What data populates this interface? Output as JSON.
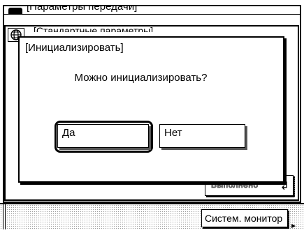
{
  "window": {
    "title": "[Параметры передачи]",
    "panel_title": "[Стандартные параметры]"
  },
  "dialog": {
    "title": "[Инициализировать]",
    "message": "Можно инициализировать?",
    "yes_label": "Да",
    "no_label": "Нет"
  },
  "background": {
    "execute_label": "Выполнено"
  },
  "footer": {
    "system_monitor_label": "Систем. монитор"
  },
  "icons": {
    "window_icon": "globe-icon",
    "panel_icon": "globe-icon",
    "return_icon": "return-arrow-icon",
    "monitor_arrow": "arrow-right-icon"
  }
}
